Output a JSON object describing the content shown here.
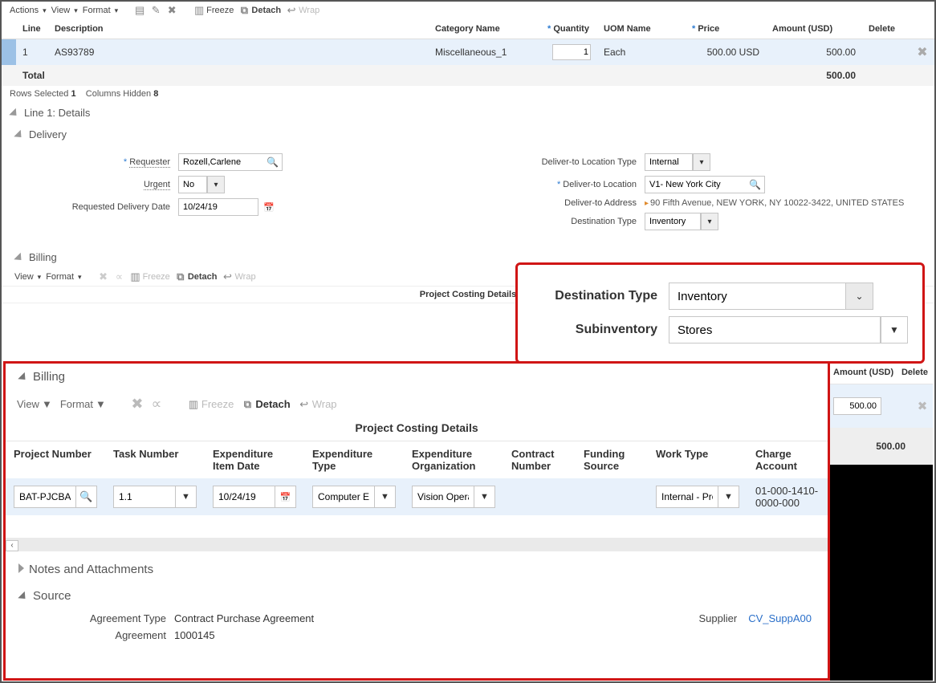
{
  "toolbar1": {
    "actions": "Actions",
    "view": "View",
    "format": "Format",
    "freeze": "Freeze",
    "detach": "Detach",
    "wrap": "Wrap"
  },
  "grid": {
    "headers": {
      "line": "Line",
      "desc": "Description",
      "cat": "Category Name",
      "qty": "Quantity",
      "uom": "UOM Name",
      "price": "Price",
      "amount": "Amount (USD)",
      "delete": "Delete"
    },
    "row": {
      "line": "1",
      "desc": "AS93789",
      "cat": "Miscellaneous_1",
      "qty": "1",
      "uom": "Each",
      "price": "500.00 USD",
      "amount": "500.00"
    },
    "total_label": "Total",
    "total_amount": "500.00"
  },
  "meta": {
    "rows_sel_label": "Rows Selected",
    "rows_sel": "1",
    "cols_hidden_label": "Columns Hidden",
    "cols_hidden": "8"
  },
  "line_details_title": "Line 1: Details",
  "delivery_title": "Delivery",
  "delivery": {
    "requester_label": "Requester",
    "requester": "Rozell,Carlene",
    "urgent_label": "Urgent",
    "urgent": "No",
    "reqdate_label": "Requested Delivery Date",
    "reqdate": "10/24/19",
    "loctype_label": "Deliver-to Location Type",
    "loctype": "Internal",
    "loc_label": "Deliver-to Location",
    "loc": "V1- New York City",
    "addr_label": "Deliver-to Address",
    "addr": "90 Fifth Avenue, NEW YORK, NY 10022-3422, UNITED STATES",
    "desttype_label": "Destination Type",
    "desttype": "Inventory"
  },
  "callout": {
    "desttype_label": "Destination Type",
    "desttype": "Inventory",
    "subinv_label": "Subinventory",
    "subinv": "Stores"
  },
  "billing_title": "Billing",
  "toolbar2": {
    "view": "View",
    "format": "Format",
    "freeze": "Freeze",
    "detach": "Detach",
    "wrap": "Wrap"
  },
  "pcd_title": "Project Costing Details",
  "lower": {
    "billing_title": "Billing",
    "toolbar": {
      "view": "View",
      "format": "Format",
      "freeze": "Freeze",
      "detach": "Detach",
      "wrap": "Wrap"
    },
    "title": "Project Costing Details",
    "headers": {
      "proj": "Project Number",
      "task": "Task Number",
      "eidate": "Expenditure Item Date",
      "etype": "Expenditure Type",
      "eorg": "Expenditure Organization",
      "contract": "Contract Number",
      "funding": "Funding Source",
      "worktype": "Work Type",
      "charge": "Charge Account"
    },
    "row": {
      "proj": "BAT-PJCBA",
      "task": "1.1",
      "eidate": "10/24/19",
      "etype": "Computer Eq",
      "eorg": "Vision Opera",
      "worktype": "Internal - Pro",
      "charge": "01-000-1410-0000-000"
    },
    "notes_title": "Notes and Attachments",
    "source_title": "Source",
    "source": {
      "agrtype_label": "Agreement Type",
      "agrtype": "Contract Purchase Agreement",
      "agr_label": "Agreement",
      "agr": "1000145",
      "supplier_label": "Supplier",
      "supplier": "CV_SuppA00"
    }
  },
  "rightstrip": {
    "amount_hdr": "Amount (USD)",
    "delete_hdr": "Delete",
    "amount": "500.00",
    "total": "500.00"
  }
}
